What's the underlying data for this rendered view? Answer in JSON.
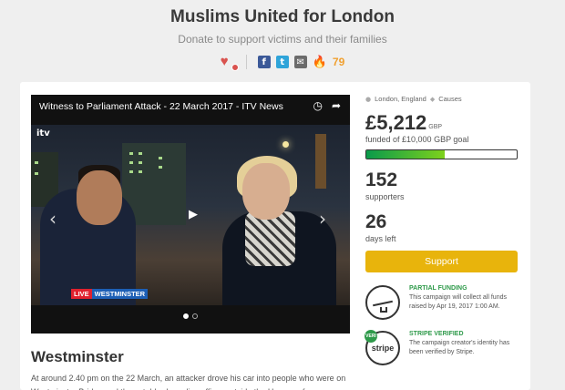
{
  "header": {
    "title": "Muslims United for London",
    "subtitle": "Donate to support victims and their families",
    "share_count": "79"
  },
  "video": {
    "title": "Witness to Parliament Attack - 22 March 2017 - ITV News",
    "logo_text": "itv",
    "ticker_live": "LIVE",
    "ticker_location": "WESTMINSTER"
  },
  "campaign": {
    "location": "London, England",
    "category": "Causes",
    "raised": "£5,212",
    "raised_currency": "GBP",
    "goal": "funded of £10,000 GBP goal",
    "progress": 0.52,
    "supporters": "152",
    "supporters_label": "supporters",
    "days": "26",
    "days_label": "days left",
    "support_button": "Support"
  },
  "partial_funding": {
    "title": "PARTIAL FUNDING",
    "text": "This campaign will collect all funds raised by Apr 19, 2017 1:00 AM."
  },
  "stripe": {
    "title": "STRIPE VERIFIED",
    "text": "The campaign creator's identity has been verified by Stripe.",
    "badge_text": "stripe",
    "tag_text": "VERI"
  },
  "story": {
    "heading": "Westminster",
    "body": "At around 2.40 pm on the 22 March, an attacker drove his car into people who were on Westminster Bridge and then stabbed a police officer outside the Houses of"
  },
  "colors": {
    "accent": "#e8b40c",
    "progress_start": "#0a9a4b",
    "progress_end": "#7ed11c",
    "verified_green": "#2e9a4a"
  }
}
